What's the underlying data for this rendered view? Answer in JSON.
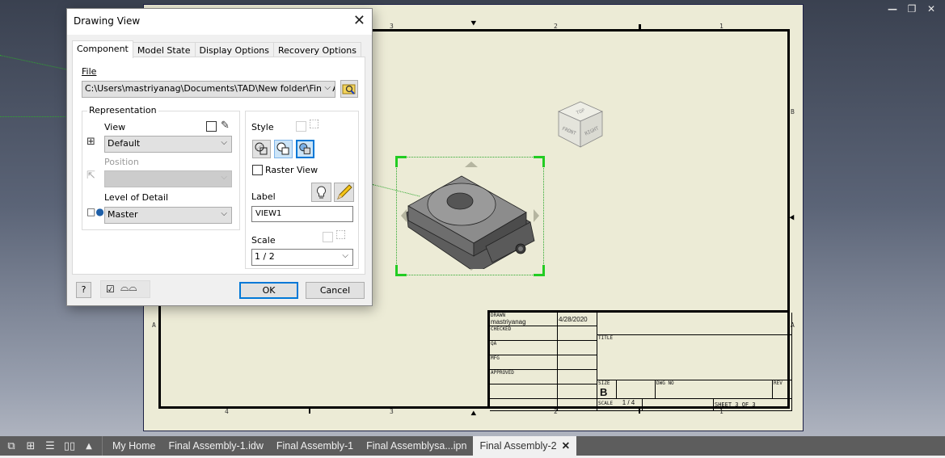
{
  "window_controls": {
    "minimize": "—",
    "restore": "❐",
    "close": "✕"
  },
  "sheet": {
    "zones_top": [
      "3",
      "2",
      "1"
    ],
    "zones_bottom": [
      "4",
      "3",
      "2",
      "1"
    ],
    "zones_left": [
      "A"
    ],
    "zones_right": [
      "B",
      "A"
    ],
    "viewcube_faces": {
      "top": "TOP",
      "front": "FRONT",
      "right": "RIGHT"
    },
    "title_block": {
      "drawn_label": "DRAWN",
      "drawn_by": "mastriyanag",
      "drawn_date": "4/28/2020",
      "checked_label": "CHECKED",
      "qa_label": "QA",
      "mfg_label": "MFG",
      "approved_label": "APPROVED",
      "title_label": "TITLE",
      "size_label": "SIZE",
      "size_value": "B",
      "dwg_no_label": "DWG NO",
      "rev_label": "REV",
      "scale_label": "SCALE",
      "scale_value": "1 / 4",
      "sheet_text": "SHEET 3  OF 3"
    }
  },
  "dialog": {
    "title": "Drawing View",
    "close_glyph": "✕",
    "tabs": [
      {
        "label": "Component",
        "active": true
      },
      {
        "label": "Model State",
        "active": false
      },
      {
        "label": "Display Options",
        "active": false
      },
      {
        "label": "Recovery Options",
        "active": false
      }
    ],
    "file_label": "File",
    "file_value": "C:\\Users\\mastriyanag\\Documents\\TAD\\New folder\\Final Asse",
    "representation": {
      "group_title": "Representation",
      "view_label": "View",
      "view_value": "Default",
      "position_label": "Position",
      "position_value": "",
      "lod_label": "Level of Detail",
      "lod_value": "Master"
    },
    "style": {
      "style_label": "Style",
      "raster_view_label": "Raster View",
      "raster_view_checked": false,
      "label_label": "Label",
      "label_value": "VIEW1",
      "scale_label": "Scale",
      "scale_value": "1 / 2"
    },
    "ok_label": "OK",
    "cancel_label": "Cancel",
    "help_glyph": "?",
    "preview_checked": true
  },
  "doc_tabs": {
    "tile_icons": [
      "cascade",
      "tile-grid",
      "tile-horizontal",
      "tile-vertical",
      "expand-up"
    ],
    "tabs": [
      {
        "label": "My Home",
        "active": false
      },
      {
        "label": "Final Assembly-1.idw",
        "active": false
      },
      {
        "label": "Final Assembly-1",
        "active": false
      },
      {
        "label": "Final Assemblysa...ipn",
        "active": false
      },
      {
        "label": "Final Assembly-2",
        "active": true
      }
    ],
    "close_glyph": "✕"
  },
  "colors": {
    "accent": "#0078d7",
    "selection": "#22cc22",
    "sheet": "#ecebd6"
  }
}
